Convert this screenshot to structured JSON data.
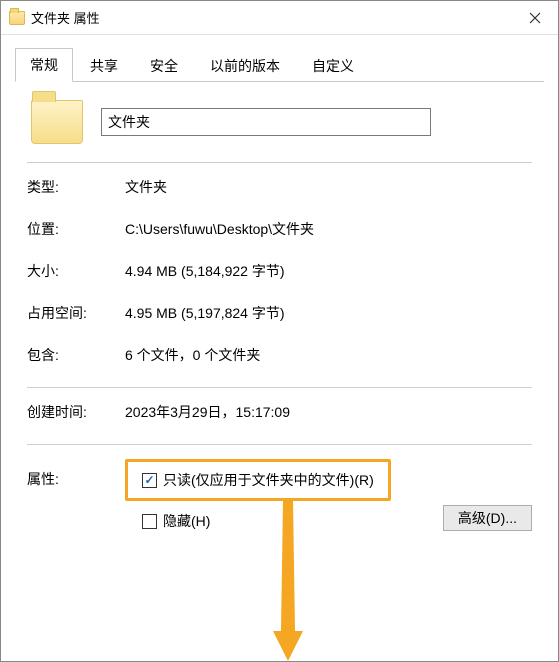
{
  "window": {
    "title": "文件夹 属性"
  },
  "tabs": {
    "items": [
      {
        "label": "常规",
        "active": true
      },
      {
        "label": "共享",
        "active": false
      },
      {
        "label": "安全",
        "active": false
      },
      {
        "label": "以前的版本",
        "active": false
      },
      {
        "label": "自定义",
        "active": false
      }
    ]
  },
  "folder_name": "文件夹",
  "props": {
    "type_label": "类型:",
    "type_value": "文件夹",
    "location_label": "位置:",
    "location_value": "C:\\Users\\fuwu\\Desktop\\文件夹",
    "size_label": "大小:",
    "size_value": "4.94 MB (5,184,922 字节)",
    "size_on_disk_label": "占用空间:",
    "size_on_disk_value": "4.95 MB (5,197,824 字节)",
    "contains_label": "包含:",
    "contains_value": "6 个文件，0 个文件夹",
    "created_label": "创建时间:",
    "created_value": "2023年3月29日，15:17:09"
  },
  "attributes": {
    "label": "属性:",
    "readonly_label": "只读(仅应用于文件夹中的文件)(R)",
    "readonly_checked": true,
    "hidden_label": "隐藏(H)",
    "hidden_checked": false,
    "advanced_button": "高级(D)..."
  },
  "colors": {
    "highlight": "#f5a623",
    "check": "#1569c7"
  }
}
